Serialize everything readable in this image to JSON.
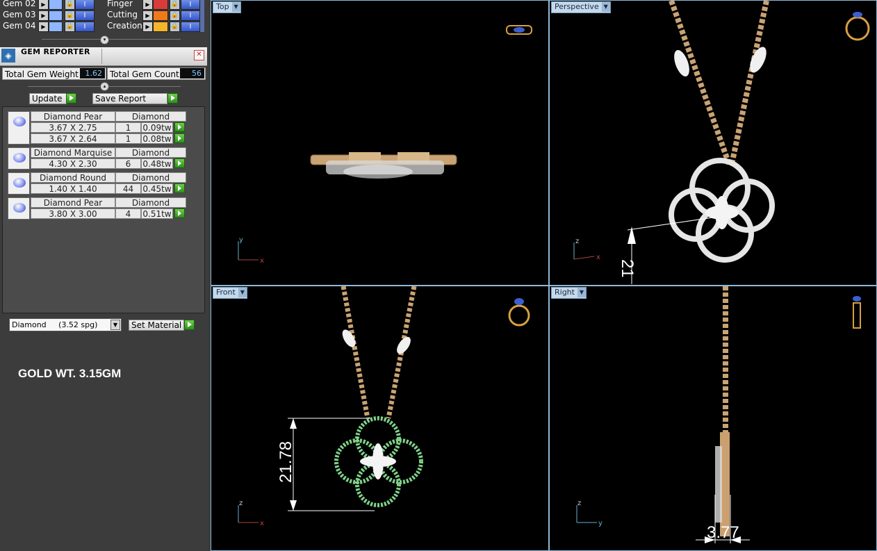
{
  "layers": {
    "left": [
      {
        "name": "Gem 02"
      },
      {
        "name": "Gem 03"
      },
      {
        "name": "Gem 04"
      }
    ],
    "right": [
      {
        "name": "Finger",
        "color": "#d93b3b"
      },
      {
        "name": "Cutting",
        "color": "#f07a1a"
      },
      {
        "name": "Creation",
        "color": "#f5b52a"
      }
    ]
  },
  "gem_reporter": {
    "title": "GEM REPORTER",
    "total_weight_label": "Total Gem Weight",
    "total_weight_value": "1.62",
    "total_count_label": "Total Gem Count",
    "total_count_value": "56",
    "update_label": "Update",
    "save_report_label": "Save Report",
    "gems": [
      {
        "shape": "Diamond Pear",
        "material": "Diamond",
        "rows": [
          {
            "size": "3.67 X 2.75",
            "qty": "1",
            "weight": "0.09tw"
          },
          {
            "size": "3.67 X 2.64",
            "qty": "1",
            "weight": "0.08tw"
          }
        ]
      },
      {
        "shape": "Diamond Marquise",
        "material": "Diamond",
        "rows": [
          {
            "size": "4.30 X 2.30",
            "qty": "6",
            "weight": "0.48tw"
          }
        ]
      },
      {
        "shape": "Diamond Round",
        "material": "Diamond",
        "rows": [
          {
            "size": "1.40 X 1.40",
            "qty": "44",
            "weight": "0.45tw"
          }
        ]
      },
      {
        "shape": "Diamond Pear",
        "material": "Diamond",
        "rows": [
          {
            "size": "3.80 X 3.00",
            "qty": "4",
            "weight": "0.51tw"
          }
        ]
      }
    ],
    "material_select": "Diamond     (3.52 spg)",
    "set_material_label": "Set Material"
  },
  "gold_weight": "GOLD WT. 3.15GM",
  "viewports": {
    "top": {
      "label": "Top",
      "axes": {
        "vertical": "y",
        "horizontal": "x"
      }
    },
    "perspective": {
      "label": "Perspective",
      "axes": {
        "vertical": "z",
        "horizontal": "x"
      },
      "dimension": "21"
    },
    "front": {
      "label": "Front",
      "axes": {
        "vertical": "z",
        "horizontal": "x"
      },
      "dimension": "21.78"
    },
    "right": {
      "label": "Right",
      "axes": {
        "vertical": "z",
        "horizontal": "y"
      },
      "dimension": "3.77"
    }
  },
  "colors": {
    "gold": "#d9b27c",
    "viewport_border": "#8fb9d8",
    "value_text": "#7fc8ff"
  }
}
